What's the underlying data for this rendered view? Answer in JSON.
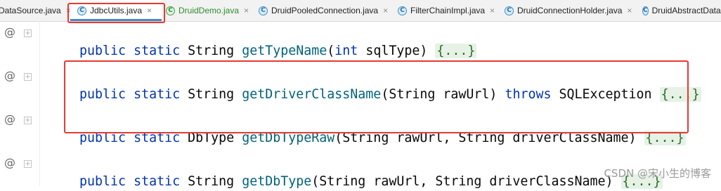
{
  "tabs": [
    {
      "label": "DataSource.java",
      "icon": "none",
      "active": false
    },
    {
      "label": "JdbcUtils.java",
      "icon": "C",
      "active": true
    },
    {
      "label": "DruidDemo.java",
      "icon": "C",
      "active": false
    },
    {
      "label": "DruidPooledConnection.java",
      "icon": "C",
      "active": false
    },
    {
      "label": "FilterChainImpl.java",
      "icon": "C",
      "active": false
    },
    {
      "label": "DruidConnectionHolder.java",
      "icon": "C",
      "active": false
    },
    {
      "label": "DruidAbstractDataSource",
      "icon": "C",
      "active": false
    }
  ],
  "tab_close_glyph": "×",
  "gutter": {
    "override_marker": "@",
    "fold_glyph": "+"
  },
  "code": {
    "line1": {
      "kw1": "public",
      "kw2": "static",
      "type": "String",
      "name": "getTypeName",
      "open": "(",
      "ptype": "int",
      "pname": " sqlType) ",
      "fold": "{...}"
    },
    "line2": {
      "kw1": "public",
      "kw2": "static",
      "type": "String",
      "name": "getDriverClassName",
      "params": "(String rawUrl) ",
      "throws": "throws",
      "exc": " SQLException ",
      "fold": "{...}"
    },
    "line3": {
      "kw1": "public",
      "kw2": "static",
      "type": "DbType",
      "name": "getDbTypeRaw",
      "params": "(String rawUrl, String driverClassName) ",
      "fold": "{...}"
    },
    "line4": {
      "kw1": "public",
      "kw2": "static",
      "type": "String",
      "name": "getDbType",
      "params": "(String rawUrl, String driverClassName) ",
      "fold": "{...}"
    }
  },
  "watermark": "CSDN @宋小生的博客",
  "colors": {
    "keyword": "#0033b3",
    "method": "#00627a",
    "highlight_box": "#e53935",
    "active_tab_underline": "#4a86c7"
  }
}
